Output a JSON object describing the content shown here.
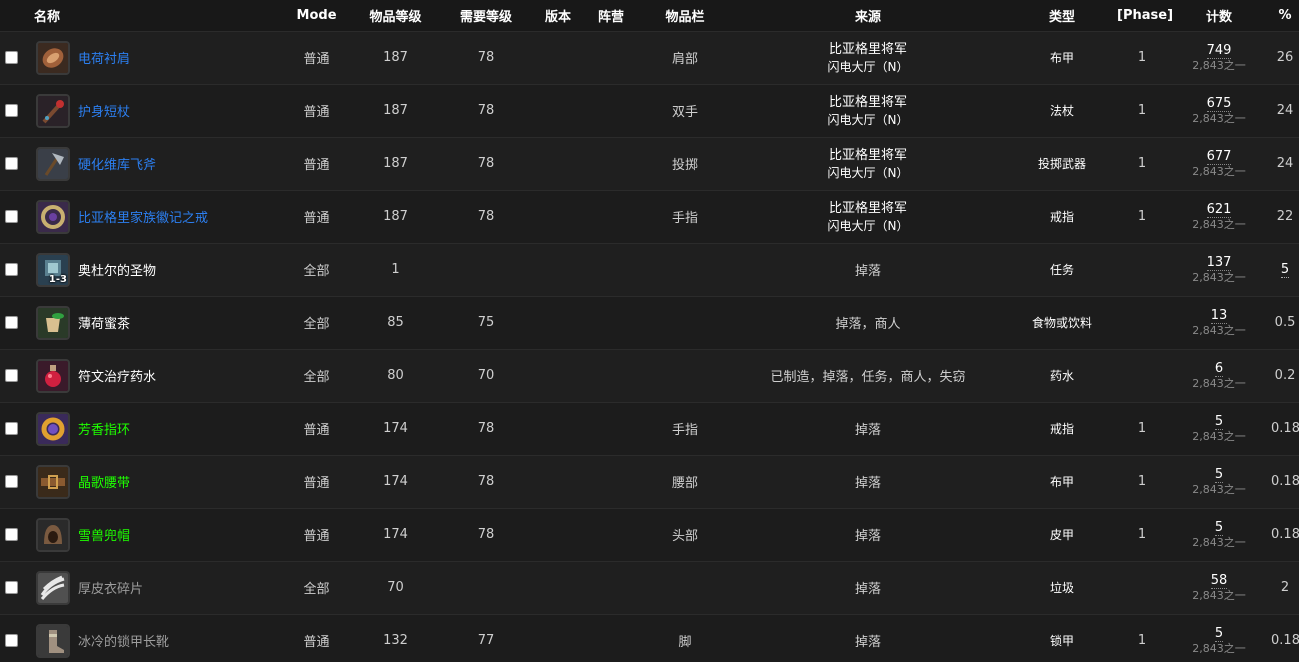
{
  "headers": {
    "name": "名称",
    "mode": "Mode",
    "item_level": "物品等级",
    "req_level": "需要等级",
    "version": "版本",
    "faction": "阵营",
    "slot": "物品栏",
    "source": "来源",
    "type": "类型",
    "phase": "[Phase]",
    "count": "计数",
    "percent": "%"
  },
  "colors": {
    "background": "#1d1d1d",
    "quality_blue": "#2c7ff0",
    "quality_green": "#1eff00",
    "quality_white": "#ffffff",
    "quality_gray": "#9d9d9d"
  },
  "rows": [
    {
      "icon": "shoulder-armor-icon",
      "name": "电荷衬肩",
      "mode": "普通",
      "item_level": "187",
      "req_level": "78",
      "version": "",
      "faction": "",
      "slot": "肩部",
      "source_main": "比亚格里将军",
      "source_sub": "闪电大厅（N）",
      "type": "布甲",
      "phase": "1",
      "count": "749",
      "count_total": "2,843之一",
      "percent": "26"
    },
    {
      "icon": "staff-icon",
      "name": "护身短杖",
      "mode": "普通",
      "item_level": "187",
      "req_level": "78",
      "version": "",
      "faction": "",
      "slot": "双手",
      "source_main": "比亚格里将军",
      "source_sub": "闪电大厅（N）",
      "type": "法杖",
      "phase": "1",
      "count": "675",
      "count_total": "2,843之一",
      "percent": "24"
    },
    {
      "icon": "throwing-axe-icon",
      "name": "硬化维库飞斧",
      "mode": "普通",
      "item_level": "187",
      "req_level": "78",
      "version": "",
      "faction": "",
      "slot": "投掷",
      "source_main": "比亚格里将军",
      "source_sub": "闪电大厅（N）",
      "type": "投掷武器",
      "phase": "1",
      "count": "677",
      "count_total": "2,843之一",
      "percent": "24"
    },
    {
      "icon": "signet-ring-icon",
      "name": "比亚格里家族徽记之戒",
      "mode": "普通",
      "item_level": "187",
      "req_level": "78",
      "version": "",
      "faction": "",
      "slot": "手指",
      "source_main": "比亚格里将军",
      "source_sub": "闪电大厅（N）",
      "type": "戒指",
      "phase": "1",
      "count": "621",
      "count_total": "2,843之一",
      "percent": "22"
    },
    {
      "icon": "relic-icon",
      "icon_badge": "1-3",
      "name": "奥杜尔的圣物",
      "mode": "全部",
      "item_level": "1",
      "req_level": "",
      "version": "",
      "faction": "",
      "slot": "",
      "source_text": "掉落",
      "type": "任务",
      "phase": "",
      "count": "137",
      "count_total": "2,843之一",
      "percent": "5"
    },
    {
      "icon": "tea-icon",
      "name": "薄荷蜜茶",
      "mode": "全部",
      "item_level": "85",
      "req_level": "75",
      "version": "",
      "faction": "",
      "slot": "",
      "source_text": "掉落，商人",
      "type": "食物或饮料",
      "phase": "",
      "count": "13",
      "count_total": "2,843之一",
      "percent": "0.5"
    },
    {
      "icon": "potion-icon",
      "name": "符文治疗药水",
      "mode": "全部",
      "item_level": "80",
      "req_level": "70",
      "version": "",
      "faction": "",
      "slot": "",
      "source_text": "已制造，掉落，任务，商人，失窃",
      "type": "药水",
      "phase": "",
      "count": "6",
      "count_total": "2,843之一",
      "percent": "0.2"
    },
    {
      "icon": "ring-icon",
      "name": "芳香指环",
      "mode": "普通",
      "item_level": "174",
      "req_level": "78",
      "version": "",
      "faction": "",
      "slot": "手指",
      "source_text": "掉落",
      "type": "戒指",
      "phase": "1",
      "count": "5",
      "count_total": "2,843之一",
      "percent": "0.18"
    },
    {
      "icon": "belt-icon",
      "name": "晶歌腰带",
      "mode": "普通",
      "item_level": "174",
      "req_level": "78",
      "version": "",
      "faction": "",
      "slot": "腰部",
      "source_text": "掉落",
      "type": "布甲",
      "phase": "1",
      "count": "5",
      "count_total": "2,843之一",
      "percent": "0.18"
    },
    {
      "icon": "hood-icon",
      "name": "雪兽兜帽",
      "mode": "普通",
      "item_level": "174",
      "req_level": "78",
      "version": "",
      "faction": "",
      "slot": "头部",
      "source_text": "掉落",
      "type": "皮甲",
      "phase": "1",
      "count": "5",
      "count_total": "2,843之一",
      "percent": "0.18"
    },
    {
      "icon": "hide-scrap-icon",
      "name": "厚皮衣碎片",
      "mode": "全部",
      "item_level": "70",
      "req_level": "",
      "version": "",
      "faction": "",
      "slot": "",
      "source_text": "掉落",
      "type": "垃圾",
      "phase": "",
      "count": "58",
      "count_total": "2,843之一",
      "percent": "2"
    },
    {
      "icon": "boots-icon",
      "name": "冰冷的锁甲长靴",
      "mode": "普通",
      "item_level": "132",
      "req_level": "77",
      "version": "",
      "faction": "",
      "slot": "脚",
      "source_text": "掉落",
      "type": "锁甲",
      "phase": "1",
      "count": "5",
      "count_total": "2,843之一",
      "percent": "0.18"
    }
  ]
}
